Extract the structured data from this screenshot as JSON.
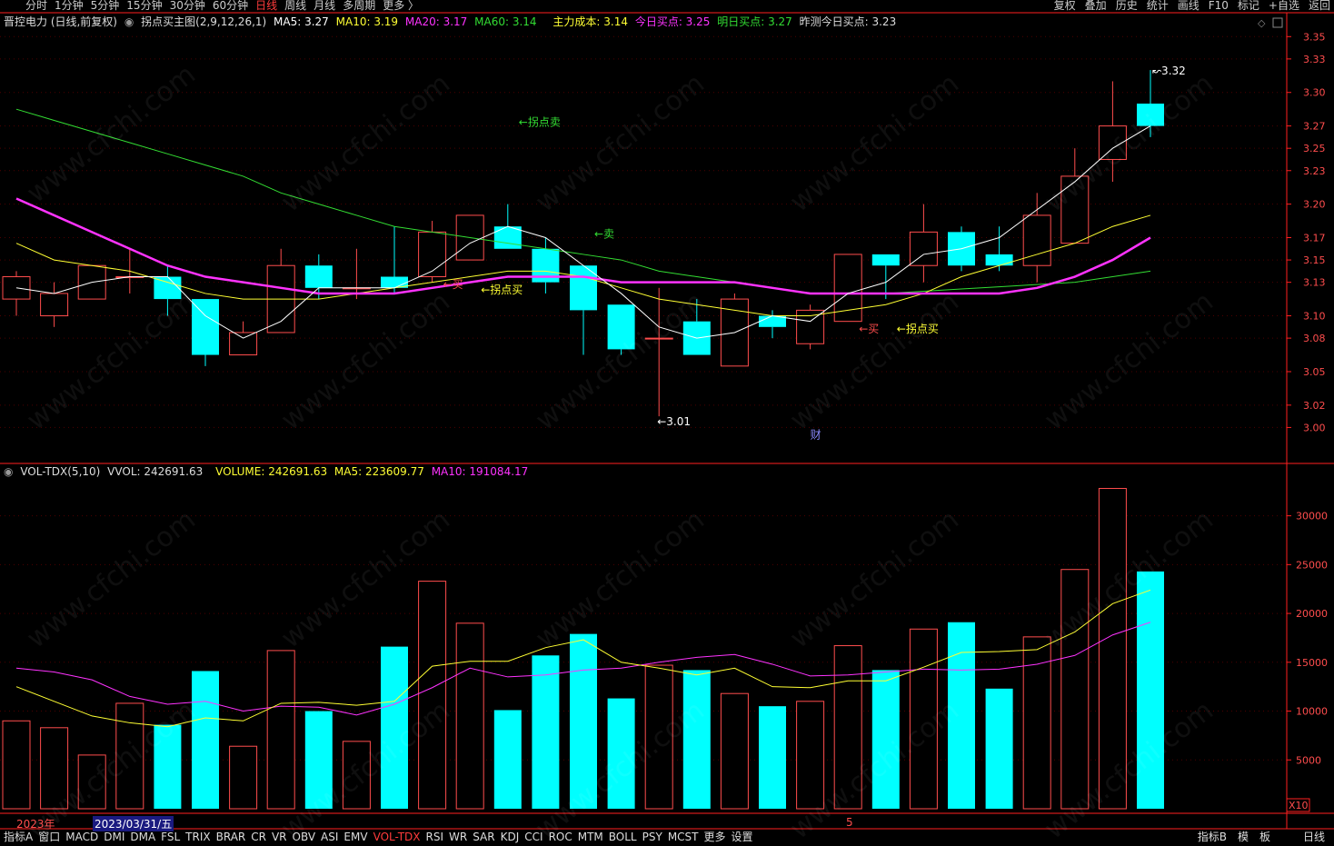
{
  "topbar": {
    "periods": [
      "分时",
      "1分钟",
      "5分钟",
      "15分钟",
      "30分钟",
      "60分钟",
      "日线",
      "周线",
      "月线",
      "多周期",
      "更多 〉"
    ],
    "active_period": "日线",
    "right_items": [
      "复权",
      "叠加",
      "历史",
      "统计",
      "画线",
      "F10",
      "标记",
      "+自选",
      "返回"
    ]
  },
  "header": {
    "stock": "晋控电力 (日线,前复权)",
    "indicator": "拐点买主图(2,9,12,26,1)",
    "ma5": "MA5: 3.27",
    "ma10": "MA10: 3.19",
    "ma20": "MA20: 3.17",
    "ma60": "MA60: 3.14",
    "cost": "主力成本: 3.14",
    "today_buy": "今日买点: 3.25",
    "tomorrow_buy": "明日买点: 3.27",
    "yesterday_buy": "昨测今日买点: 3.23"
  },
  "volume_header": {
    "name": "VOL-TDX(5,10)",
    "vvol": "VVOL: 242691.63",
    "volume": "VOLUME: 242691.63",
    "ma5": "MA5: 223609.77",
    "ma10": "MA10: 191084.17"
  },
  "bottombar": {
    "tabs": [
      "指标A",
      "窗口",
      "MACD",
      "DMI",
      "DMA",
      "FSL",
      "TRIX",
      "BRAR",
      "CR",
      "VR",
      "OBV",
      "ASI",
      "EMV",
      "VOL-TDX",
      "RSI",
      "WR",
      "SAR",
      "KDJ",
      "CCI",
      "ROC",
      "MTM",
      "BOLL",
      "PSY",
      "MCST",
      "更多",
      "设置"
    ],
    "active_tab": "VOL-TDX",
    "right_items": [
      "指标B",
      "模",
      "板",
      "日线"
    ]
  },
  "datebar": {
    "year": "2023年",
    "cursor_date": "2023/03/31/五",
    "month_mark": "5"
  },
  "colors": {
    "up": "#ff4d4d",
    "down": "#00ffff",
    "ma5": "#ffffff",
    "ma10": "#ffff33",
    "ma20": "#ff33ff",
    "ma60": "#33dd33",
    "axis": "#ff2020",
    "grid": "#4d0000"
  },
  "chart_data": {
    "type": "candlestick",
    "price_axis": {
      "ticks": [
        3.35,
        3.33,
        3.3,
        3.27,
        3.25,
        3.23,
        3.2,
        3.17,
        3.15,
        3.13,
        3.1,
        3.08,
        3.05,
        3.02,
        3.0
      ],
      "ylim": [
        2.98,
        3.36
      ]
    },
    "candles": [
      {
        "o": 3.115,
        "c": 3.135,
        "h": 3.14,
        "l": 3.1
      },
      {
        "o": 3.1,
        "c": 3.12,
        "h": 3.13,
        "l": 3.09
      },
      {
        "o": 3.115,
        "c": 3.145,
        "h": 3.145,
        "l": 3.115
      },
      {
        "o": 3.135,
        "c": 3.135,
        "h": 3.16,
        "l": 3.12
      },
      {
        "o": 3.135,
        "c": 3.115,
        "h": 3.145,
        "l": 3.1
      },
      {
        "o": 3.115,
        "c": 3.065,
        "h": 3.115,
        "l": 3.055
      },
      {
        "o": 3.065,
        "c": 3.085,
        "h": 3.095,
        "l": 3.065
      },
      {
        "o": 3.085,
        "c": 3.145,
        "h": 3.16,
        "l": 3.085
      },
      {
        "o": 3.145,
        "c": 3.125,
        "h": 3.155,
        "l": 3.115
      },
      {
        "o": 3.125,
        "c": 3.125,
        "h": 3.16,
        "l": 3.115
      },
      {
        "o": 3.135,
        "c": 3.125,
        "h": 3.18,
        "l": 3.12
      },
      {
        "o": 3.135,
        "c": 3.175,
        "h": 3.185,
        "l": 3.13
      },
      {
        "o": 3.15,
        "c": 3.19,
        "h": 3.19,
        "l": 3.15
      },
      {
        "o": 3.18,
        "c": 3.16,
        "h": 3.2,
        "l": 3.16
      },
      {
        "o": 3.16,
        "c": 3.13,
        "h": 3.17,
        "l": 3.12
      },
      {
        "o": 3.145,
        "c": 3.105,
        "h": 3.145,
        "l": 3.065
      },
      {
        "o": 3.11,
        "c": 3.07,
        "h": 3.11,
        "l": 3.065
      },
      {
        "o": 3.08,
        "c": 3.08,
        "h": 3.125,
        "l": 3.01
      },
      {
        "o": 3.095,
        "c": 3.065,
        "h": 3.115,
        "l": 3.065
      },
      {
        "o": 3.055,
        "c": 3.115,
        "h": 3.12,
        "l": 3.055
      },
      {
        "o": 3.1,
        "c": 3.09,
        "h": 3.105,
        "l": 3.08
      },
      {
        "o": 3.075,
        "c": 3.105,
        "h": 3.11,
        "l": 3.07
      },
      {
        "o": 3.095,
        "c": 3.155,
        "h": 3.155,
        "l": 3.095
      },
      {
        "o": 3.155,
        "c": 3.145,
        "h": 3.155,
        "l": 3.115
      },
      {
        "o": 3.145,
        "c": 3.175,
        "h": 3.2,
        "l": 3.13
      },
      {
        "o": 3.175,
        "c": 3.145,
        "h": 3.18,
        "l": 3.14
      },
      {
        "o": 3.155,
        "c": 3.145,
        "h": 3.18,
        "l": 3.14
      },
      {
        "o": 3.145,
        "c": 3.19,
        "h": 3.21,
        "l": 3.13
      },
      {
        "o": 3.165,
        "c": 3.225,
        "h": 3.25,
        "l": 3.165
      },
      {
        "o": 3.24,
        "c": 3.27,
        "h": 3.31,
        "l": 3.22
      },
      {
        "o": 3.29,
        "c": 3.27,
        "h": 3.32,
        "l": 3.26
      }
    ],
    "ma5": [
      3.125,
      3.12,
      3.13,
      3.135,
      3.135,
      3.1,
      3.08,
      3.095,
      3.125,
      3.125,
      3.125,
      3.14,
      3.165,
      3.18,
      3.17,
      3.145,
      3.12,
      3.09,
      3.08,
      3.085,
      3.1,
      3.095,
      3.12,
      3.13,
      3.155,
      3.16,
      3.17,
      3.195,
      3.22,
      3.25,
      3.27
    ],
    "ma10": [
      3.165,
      3.15,
      3.145,
      3.14,
      3.13,
      3.12,
      3.115,
      3.115,
      3.115,
      3.12,
      3.125,
      3.13,
      3.135,
      3.14,
      3.14,
      3.135,
      3.125,
      3.115,
      3.11,
      3.105,
      3.1,
      3.1,
      3.105,
      3.11,
      3.12,
      3.135,
      3.145,
      3.155,
      3.165,
      3.18,
      3.19
    ],
    "ma20": [
      3.205,
      3.19,
      3.175,
      3.16,
      3.145,
      3.135,
      3.13,
      3.125,
      3.12,
      3.12,
      3.12,
      3.125,
      3.13,
      3.135,
      3.135,
      3.135,
      3.13,
      3.13,
      3.13,
      3.13,
      3.125,
      3.12,
      3.12,
      3.12,
      3.12,
      3.12,
      3.12,
      3.125,
      3.135,
      3.15,
      3.17
    ],
    "ma60": [
      3.285,
      3.275,
      3.265,
      3.255,
      3.245,
      3.235,
      3.225,
      3.21,
      3.2,
      3.19,
      3.18,
      3.175,
      3.17,
      3.165,
      3.16,
      3.155,
      3.15,
      3.14,
      3.135,
      3.13,
      3.125,
      3.12,
      3.12,
      3.12,
      3.122,
      3.124,
      3.126,
      3.128,
      3.13,
      3.135,
      3.14
    ],
    "high_label": "3.32",
    "low_label": "3.01",
    "annotations": [
      {
        "text": "←拐点卖",
        "color": "#33dd33",
        "i": 13,
        "y": 3.27
      },
      {
        "text": "←卖",
        "color": "#33dd33",
        "i": 15,
        "y": 3.17
      },
      {
        "text": "←买",
        "color": "#ff4d4d",
        "i": 11,
        "y": 3.125
      },
      {
        "text": "←拐点买",
        "color": "#ffff33",
        "i": 12,
        "y": 3.12
      },
      {
        "text": "←买",
        "color": "#ff4d4d",
        "i": 22,
        "y": 3.085
      },
      {
        "text": "←拐点买",
        "color": "#ffff33",
        "i": 23,
        "y": 3.085
      },
      {
        "text": "财",
        "color": "#8a8aff",
        "i": 21,
        "y": 2.99
      }
    ],
    "volume_axis": {
      "ticks": [
        30000,
        25000,
        20000,
        15000,
        10000,
        5000
      ],
      "ylim": [
        0,
        33500
      ],
      "unit": "X10"
    },
    "volume": [
      9000,
      8300,
      5500,
      10800,
      8600,
      14100,
      6400,
      16200,
      10000,
      6900,
      16600,
      23300,
      19000,
      10100,
      15700,
      17900,
      11300,
      14700,
      14200,
      11800,
      10500,
      11000,
      16700,
      14200,
      18400,
      19100,
      12300,
      17600,
      24500,
      32800,
      24300
    ],
    "vol_ma5": [
      12500,
      11000,
      9500,
      8800,
      8400,
      9300,
      9000,
      10800,
      10900,
      10600,
      11000,
      14600,
      15100,
      15100,
      16500,
      17300,
      15000,
      14400,
      13700,
      14400,
      12500,
      12400,
      13100,
      13100,
      14500,
      16000,
      16100,
      16300,
      18100,
      21000,
      22400
    ],
    "vol_ma10": [
      14400,
      14000,
      13200,
      11500,
      10700,
      11000,
      10000,
      10500,
      10400,
      9600,
      10700,
      12400,
      14400,
      13500,
      13700,
      14200,
      14400,
      15000,
      15500,
      15800,
      14800,
      13600,
      13700,
      14000,
      14300,
      14200,
      14300,
      14800,
      15700,
      17800,
      19100
    ]
  }
}
